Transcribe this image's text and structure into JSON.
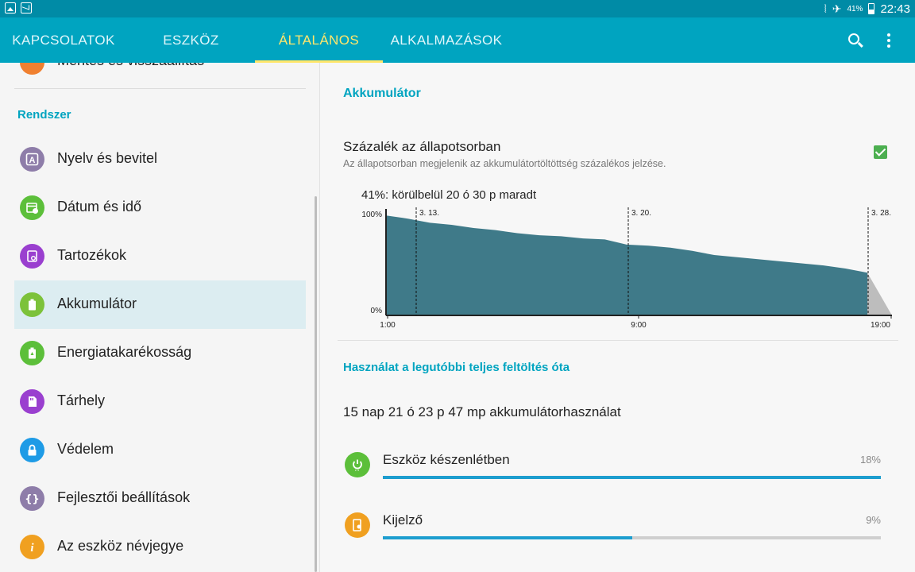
{
  "status_bar": {
    "left_icons": [
      "image-icon",
      "mail-icon"
    ],
    "right_icons": [
      "vibrate-icon",
      "airplane-mode-icon",
      "battery-icon"
    ],
    "battery_percent": "41%",
    "time": "22:43"
  },
  "tabs": [
    {
      "label": "KAPCSOLATOK",
      "active": false
    },
    {
      "label": "ESZKÖZ",
      "active": false
    },
    {
      "label": "ÁLTALÁNOS",
      "active": true
    },
    {
      "label": "ALKALMAZÁSOK",
      "active": false
    }
  ],
  "toolbar_icons": [
    "search-icon",
    "more-options-icon"
  ],
  "sidebar": {
    "cut_off_item": "Mentés és visszaállítás",
    "section_title": "Rendszer",
    "items": [
      {
        "label": "Nyelv és bevitel",
        "icon": "language-icon",
        "color": "#8e7da9",
        "active": false
      },
      {
        "label": "Dátum és idő",
        "icon": "calendar-clock-icon",
        "color": "#5cbf3a",
        "active": false
      },
      {
        "label": "Tartozékok",
        "icon": "accessories-icon",
        "color": "#9a3fcf",
        "active": false
      },
      {
        "label": "Akkumulátor",
        "icon": "battery-icon",
        "color": "#7cc23a",
        "active": true
      },
      {
        "label": "Energiatakarékosság",
        "icon": "power-saving-icon",
        "color": "#5cbf3a",
        "active": false
      },
      {
        "label": "Tárhely",
        "icon": "storage-icon",
        "color": "#9a3fcf",
        "active": false
      },
      {
        "label": "Védelem",
        "icon": "lock-icon",
        "color": "#1e9be6",
        "active": false
      },
      {
        "label": "Fejlesztői beállítások",
        "icon": "developer-braces-icon",
        "color": "#8e7da9",
        "active": false
      },
      {
        "label": "Az eszköz névjegye",
        "icon": "info-icon",
        "color": "#f0a020",
        "active": false
      }
    ]
  },
  "main": {
    "title": "Akkumulátor",
    "percent_row": {
      "title": "Százalék az állapotsorban",
      "subtitle": "Az állapotsorban megjelenik az akkumulátortöltöttség százalékos jelzése.",
      "checked": true
    },
    "remaining_text": "41%: körülbelül 20 ó 30 p maradt",
    "usage_section_title": "Használat a legutóbbi teljes feltöltés óta",
    "usage_total": "15 nap 21 ó 23 p 47 mp akkumulátorhasználat",
    "usage_items": [
      {
        "name": "Eszköz készenlétben",
        "percent": "18%",
        "fraction": 1.0,
        "icon": "power-icon",
        "color": "#5cbf3a"
      },
      {
        "name": "Kijelző",
        "percent": "9%",
        "fraction": 0.5,
        "icon": "display-brightness-icon",
        "color": "#f0a020"
      }
    ]
  },
  "chart_data": {
    "type": "area",
    "y_labels": [
      "100%",
      "0%"
    ],
    "ylim": [
      0,
      100
    ],
    "x_tick_labels": [
      "1:00",
      "9:00",
      "19:00"
    ],
    "date_markers": [
      "3. 13.",
      "3. 20.",
      "3. 28."
    ],
    "series": [
      {
        "values": [
          96,
          93,
          89,
          87,
          84,
          82,
          79,
          77,
          76,
          74,
          73,
          68,
          67,
          65,
          62,
          58,
          56,
          54,
          52,
          50,
          48,
          45,
          41
        ]
      }
    ],
    "projection": {
      "from": 41,
      "to": 0
    },
    "grid": false,
    "colors": {
      "used": "#3f7a89",
      "projection": "#bdbdbd"
    }
  }
}
